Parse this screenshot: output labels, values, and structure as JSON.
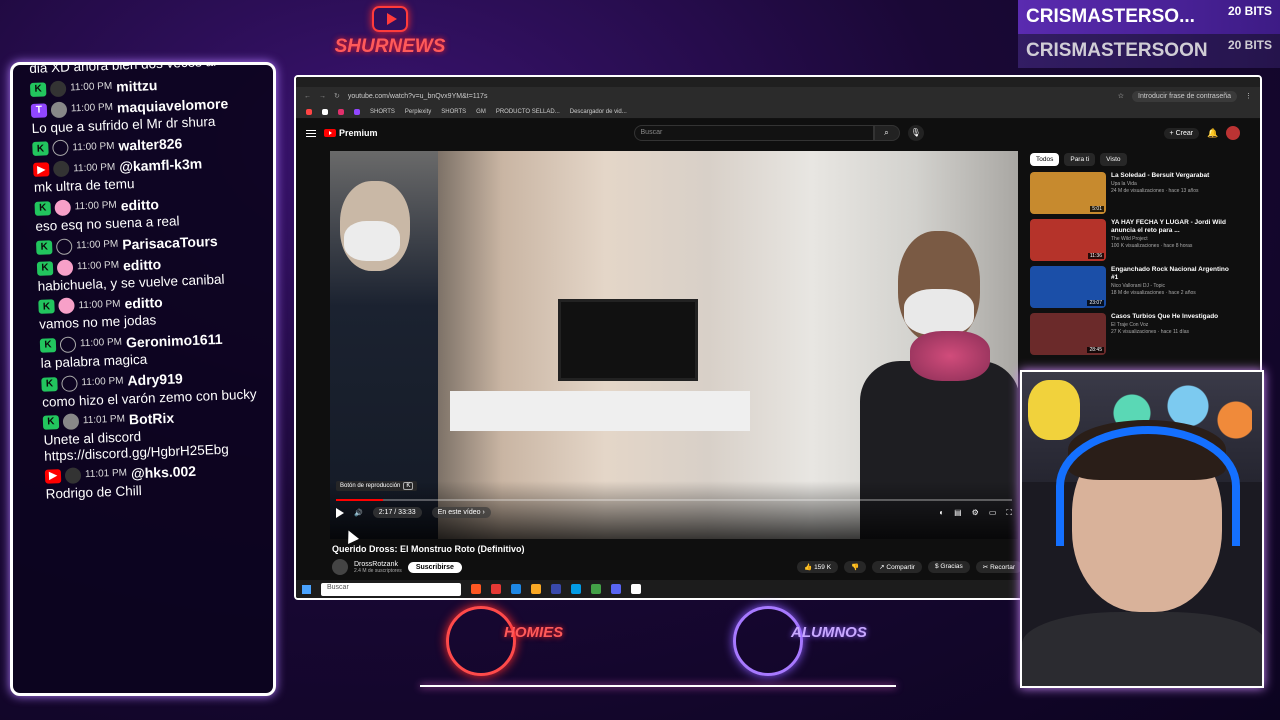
{
  "overlay": {
    "brand": "SHURNEWS",
    "bits": [
      {
        "name": "CRISMASTERSO...",
        "amount": "20 BITS"
      },
      {
        "name": "CRISMASTERSOON",
        "amount": "20 BITS"
      }
    ],
    "logo_left": "HOMIES",
    "logo_right": "ALUMNOS"
  },
  "chat": {
    "messages": [
      {
        "time": "",
        "user": "",
        "text": "dia XD    ahora bien dos veces al"
      },
      {
        "time": "11:00 PM",
        "user": "mittzu",
        "text": ""
      },
      {
        "time": "11:00 PM",
        "user": "maquiavelomore",
        "text": "Lo que a sufrido el Mr dr shura"
      },
      {
        "time": "11:00 PM",
        "user": "walter826",
        "text": ""
      },
      {
        "time": "11:00 PM",
        "user": "@kamfl-k3m",
        "text": "mk ultra de temu"
      },
      {
        "time": "11:00 PM",
        "user": "editto",
        "text": "eso esq no suena a real"
      },
      {
        "time": "11:00 PM",
        "user": "ParisacaTours",
        "text": ""
      },
      {
        "time": "11:00 PM",
        "user": "editto",
        "text": "habichuela, y se vuelve canibal"
      },
      {
        "time": "11:00 PM",
        "user": "editto",
        "text": "vamos no me jodas"
      },
      {
        "time": "11:00 PM",
        "user": "Geronimo1611",
        "text": "la palabra magica"
      },
      {
        "time": "11:00 PM",
        "user": "Adry919",
        "text": "como hizo el varón zemo con bucky"
      },
      {
        "time": "11:01 PM",
        "user": "BotRix",
        "text": "Unete al discord https://discord.gg/HgbrH25Ebg"
      },
      {
        "time": "11:01 PM",
        "user": "@hks.002",
        "text": "Rodrigo de Chill"
      }
    ]
  },
  "browser": {
    "url": "youtube.com/watch?v=u_bnQvx9YM&t=117s",
    "password_prompt": "Introducir frase de contraseña",
    "bookmarks": [
      "SHORTS",
      "Perplexity",
      "SHORTS",
      "GM",
      "PRODUCTO SELLAD...",
      "Descargador de vid..."
    ],
    "yt": {
      "logo": "Premium",
      "search_placeholder": "Buscar",
      "create": "Crear",
      "player": {
        "tooltip": "Botón de reproducción",
        "tooltip_key": "K",
        "time": "2:17 / 33:33",
        "chapter": "En este vídeo",
        "progress": 0.07
      },
      "video_title": "Querido Dross: El Monstruo Roto (Definitivo)",
      "channel": "DrossRotzank",
      "subs": "2.4 M de suscriptores",
      "subscribe": "Suscribirse",
      "actions": [
        "159 K",
        "Compartir",
        "Gracias",
        "Recortar"
      ],
      "chips": [
        "Todos",
        "Para ti",
        "Visto"
      ],
      "recs": [
        {
          "title": "La Soledad - Bersuit Vergarabat",
          "channel": "Upa la Vida",
          "stats": "24 M de visualizaciones · hace 13 años",
          "dur": "5:01",
          "color": "#c78a2e"
        },
        {
          "title": "YA HAY FECHA Y LUGAR - Jordi Wild anuncia el reto para ...",
          "channel": "The Wild Project",
          "stats": "100 K visualizaciones · hace 8 horas",
          "dur": "11:36",
          "color": "#b5332a"
        },
        {
          "title": "Enganchado Rock Nacional Argentino #1",
          "channel": "Nico Vallorani DJ - Topic",
          "stats": "18 M de visualizaciones · hace 2 años",
          "dur": "23:07",
          "color": "#1b4fa8"
        },
        {
          "title": "Casos Turbios Que He Investigado",
          "channel": "El Traje Con Voz",
          "stats": "27 K visualizaciones · hace 11 días",
          "dur": "28:45",
          "color": "#6b2a2a"
        }
      ]
    },
    "taskbar_search": "Buscar"
  }
}
